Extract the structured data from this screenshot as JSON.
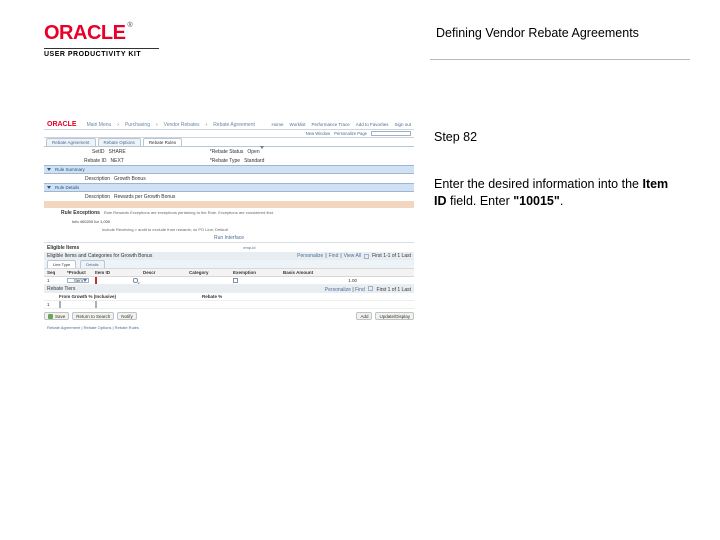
{
  "header": {
    "title": "Defining Vendor Rebate Agreements"
  },
  "logo": {
    "brand": "ORACLE",
    "tm": "®",
    "kit": "USER PRODUCTIVITY KIT"
  },
  "instructions": {
    "step": "Step 82",
    "line1": "Enter the desired information into the ",
    "field_label": "Item ID",
    "line2": " field. Enter ",
    "value": "\"10015\"",
    "line3": "."
  },
  "app": {
    "crumbs": [
      "Main Menu",
      "Purchasing",
      "Vendor Rebates",
      "Rebate Agreement"
    ],
    "top_nav": [
      "Home",
      "Worklist",
      "Performance Trace",
      "Add to Favorites",
      "Sign out"
    ],
    "sub_nav": {
      "new_window": "New Window",
      "personalize": "Personalize Page"
    },
    "tabs": [
      "Rebate Agreement",
      "Rebate Options",
      "Rebate Rules"
    ],
    "active_tab": 2,
    "setid_label": "SetID",
    "setid_value": "SHARE",
    "rule_id_label": "Rebate ID",
    "rule_id_value": "NEXT",
    "status_label": "*Rebate Status",
    "status_value": "Open",
    "type_label": "*Rebate Type",
    "type_value": "Standard",
    "rule_summary": {
      "title": "Rule Summary",
      "description_label": "Description",
      "description_value": "Growth Bonus"
    },
    "rule_details": {
      "title": "Rule Details",
      "desc_label": "Description",
      "desc_value": "Rewards per Growth Bonus"
    },
    "rule_exceptions": {
      "title": "Rule Exceptions",
      "note1": "Rule Rewards Exceptions are exceptions pertaining to the Rule. Exceptions are considered first.",
      "info_value": "Info 400200 for 1,000",
      "note2": "Include Receiving > audit to exclude from rewards; no PO Line; Default"
    },
    "interface": {
      "label": "Run Interface"
    },
    "eligible_items": {
      "title": "Eligible Items",
      "subtitle": "Eligible Items and Categories for Growth Bonus",
      "toolbar": {
        "personalize": "Personalize",
        "find": "Find",
        "viewall": "View All",
        "range": "First 1-1 of 1 Last"
      },
      "subtabs": [
        "Line Type",
        "Details"
      ],
      "columns": [
        "Seq",
        "*Product",
        "Item ID",
        "",
        "Descr",
        "Category",
        "Exemption",
        "Basis Amount"
      ],
      "row": {
        "seq": "1",
        "product": "Item",
        "item_input": "",
        "descr": "",
        "category": "",
        "exemption": "",
        "basis": "1.00"
      }
    },
    "rebate_tiers": {
      "title": "Rebate Tiers",
      "toolbar": {
        "personalize": "Personalize",
        "find": "Find",
        "range": "First 1 of 1 Last"
      },
      "columns": [
        "",
        "From Growth % (Inclusive)",
        "Rebate %"
      ]
    },
    "footer_buttons": {
      "save": "Save",
      "return": "Return to Search",
      "notify": "Notify",
      "add": "Add",
      "update": "Update/Display"
    },
    "footer_links": "Rebate Agreement | Rebate Options | Rebate Rules"
  }
}
